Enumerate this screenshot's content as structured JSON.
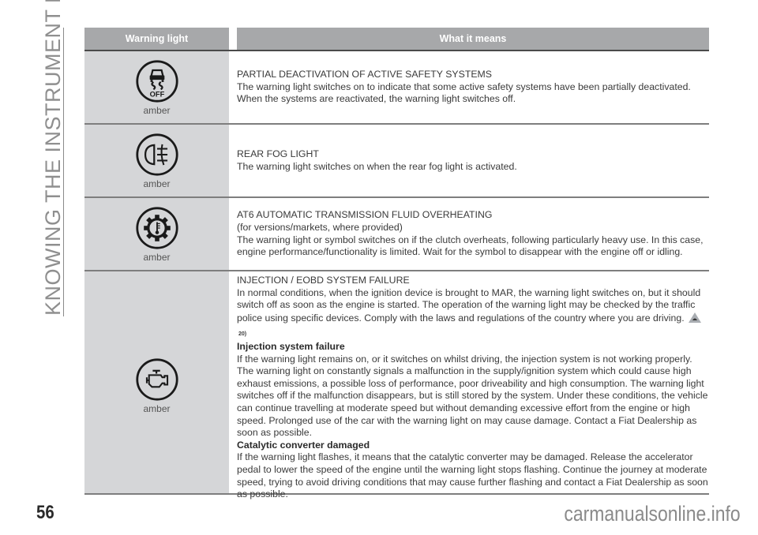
{
  "section_title": "KNOWING THE INSTRUMENT PANEL",
  "page_number": "56",
  "watermark": "carmanualsonline.info",
  "table": {
    "headers": [
      "Warning light",
      "What it means"
    ],
    "rows": [
      {
        "icon": "traction-control-off-icon",
        "icon_label": "OFF",
        "color": "amber",
        "title": "PARTIAL DEACTIVATION OF ACTIVE SAFETY SYSTEMS",
        "paragraphs": [
          "The warning light switches on to indicate that some active safety systems have been partially deactivated. When the systems are reactivated, the warning light switches off."
        ]
      },
      {
        "icon": "rear-fog-light-icon",
        "color": "amber",
        "title": "REAR FOG LIGHT",
        "paragraphs": [
          "The warning light switches on when the rear fog light is activated."
        ]
      },
      {
        "icon": "transmission-temperature-icon",
        "color": "amber",
        "title": "AT6 AUTOMATIC TRANSMISSION FLUID OVERHEATING",
        "paragraphs": [
          "(for versions/markets, where provided)",
          "The warning light or symbol switches on if the clutch overheats, following particularly heavy use. In this case, engine performance/functionality is limited. Wait for the symbol to disappear with the engine off or idling."
        ]
      },
      {
        "icon": "check-engine-icon",
        "color": "amber",
        "title": "INJECTION / EOBD SYSTEM FAILURE",
        "intro": "In normal conditions, when the ignition device is brought to MAR, the warning light switches on, but it should switch off as soon as the engine is started. The operation of the warning light may be checked by the traffic police using specific devices. Comply with the laws and regulations of the country where you are driving.",
        "reference": "20)",
        "subsections": [
          {
            "heading": "Injection system failure",
            "text": "If the warning light remains on, or it switches on whilst driving, the injection system is not working properly. The warning light on constantly signals a malfunction in the supply/ignition system which could cause high exhaust emissions, a possible loss of performance, poor driveability and high consumption. The warning light switches off if the malfunction disappears, but is still stored by the system. Under these conditions, the vehicle can continue travelling at moderate speed but without demanding excessive effort from the engine or high speed. Prolonged use of the car with the warning light on may cause damage. Contact a Fiat Dealership as soon as possible."
          },
          {
            "heading": "Catalytic converter damaged",
            "text": "If the warning light flashes, it means that the catalytic converter may be damaged. Release the accelerator pedal to lower the speed of the engine until the warning light stops flashing. Continue the journey at moderate speed, trying to avoid driving conditions that may cause further flashing and contact a Fiat Dealership as soon as possible."
          }
        ]
      }
    ]
  }
}
